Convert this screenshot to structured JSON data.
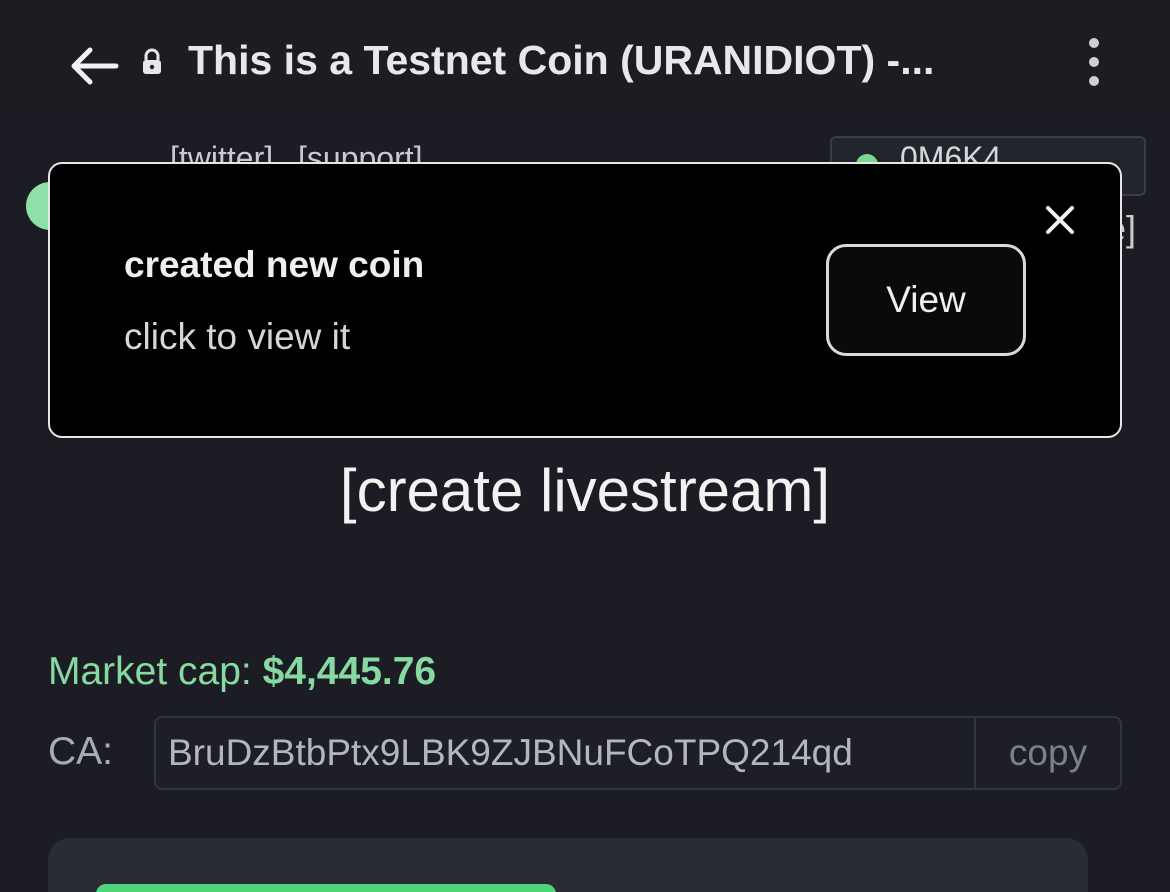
{
  "browser": {
    "title": "This is a Testnet Coin (URANIDIOT) -...",
    "back_icon": "arrow-left-icon",
    "lock_icon": "lock-icon",
    "menu_icon": "kebab-menu-icon"
  },
  "background": {
    "links": [
      "[twitter]",
      "[support]"
    ],
    "partial_box_text": "0M6K4...",
    "partial_bracket": "e]"
  },
  "toast": {
    "title": "created new coin",
    "description": "click to view it",
    "view_label": "View",
    "close_icon": "close-icon"
  },
  "main": {
    "livestream_label": "[create livestream]",
    "market_cap_label": "Market cap:",
    "market_cap_value": "$4,445.76",
    "ca_label": "CA:",
    "ca_value": "BruDzBtbPtx9LBK9ZJBNuFCoTPQ214qd",
    "copy_label": "copy"
  },
  "colors": {
    "background": "#1c1d24",
    "accent_green": "#86d9a0",
    "toast_bg": "#000000"
  }
}
